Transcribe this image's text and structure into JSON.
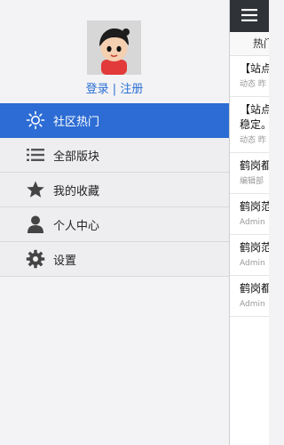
{
  "profile": {
    "login_label": "登录",
    "separator": "|",
    "register_label": "注册"
  },
  "menu": [
    {
      "label": "社区热门",
      "icon": "sun-icon",
      "active": true
    },
    {
      "label": "全部版块",
      "icon": "list-icon",
      "active": false
    },
    {
      "label": "我的收藏",
      "icon": "star-icon",
      "active": false
    },
    {
      "label": "个人中心",
      "icon": "user-icon",
      "active": false
    },
    {
      "label": "设置",
      "icon": "gear-icon",
      "active": false
    }
  ],
  "content": {
    "tab_label": "热门",
    "items": [
      {
        "title_lines": [
          "【站点"
        ],
        "meta": "动态 昨"
      },
      {
        "title_lines": [
          "【站点",
          "稳定。"
        ],
        "meta": "动态 昨"
      },
      {
        "title_lines": [
          "鹤岗都"
        ],
        "meta": "编辑部"
      },
      {
        "title_lines": [
          "鹤岗范"
        ],
        "meta": "Admin"
      },
      {
        "title_lines": [
          "鹤岗范"
        ],
        "meta": "Admin"
      },
      {
        "title_lines": [
          "鹤岗都"
        ],
        "meta": "Admin"
      }
    ]
  },
  "colors": {
    "accent": "#2c6cd4",
    "topbar": "#2f3237"
  }
}
